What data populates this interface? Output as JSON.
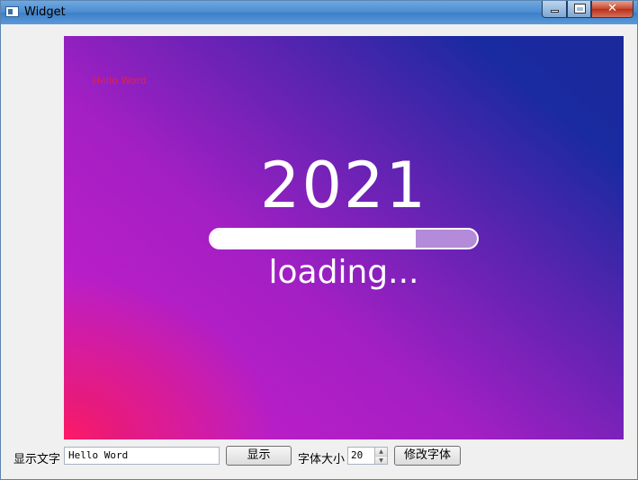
{
  "window": {
    "title": "Widget"
  },
  "image": {
    "overlay_text": "Hello Word",
    "year": "2021",
    "progress": 0.77,
    "loading_text": "loading..."
  },
  "controls": {
    "text_label": "显示文字",
    "text_value": "Hello Word",
    "show_button": "显示",
    "size_label": "字体大小",
    "size_value": "20",
    "font_button": "修改字体"
  }
}
